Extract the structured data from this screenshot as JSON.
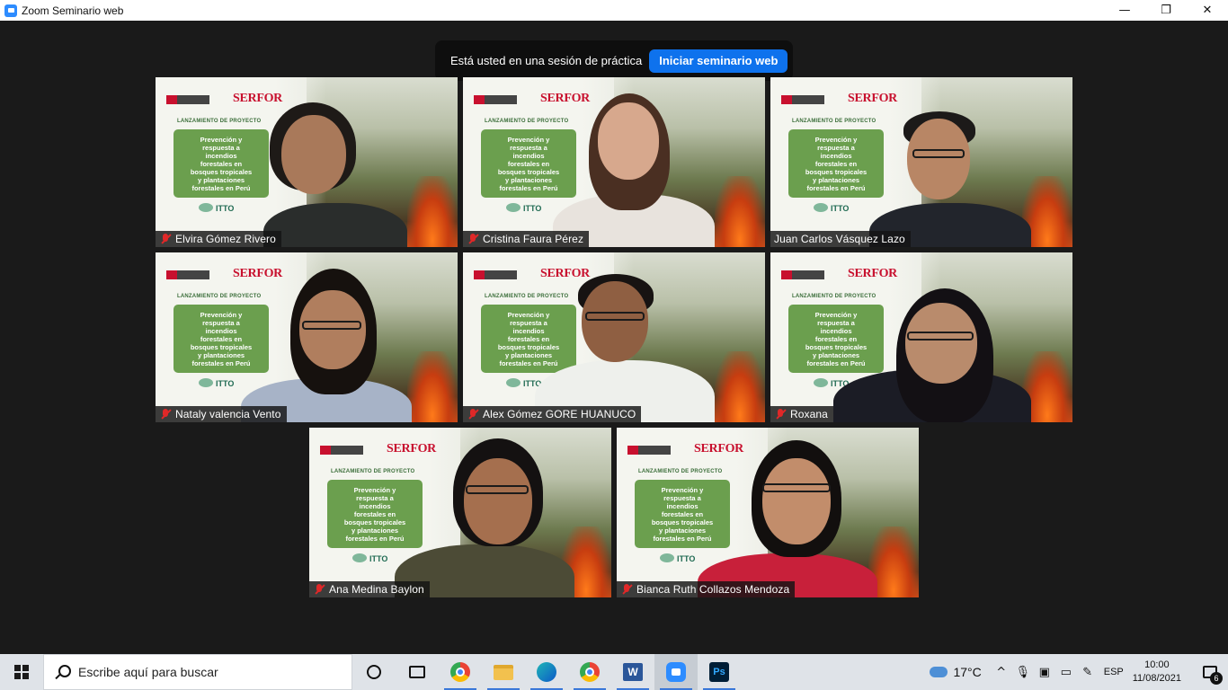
{
  "window": {
    "title": "Zoom Seminario web",
    "minimize": "—",
    "maximize": "❐",
    "close": "✕"
  },
  "banner": {
    "text": "Está usted en una sesión de práctica",
    "button": "Iniciar seminario web"
  },
  "slide": {
    "brand": "SERFOR",
    "label": "LANZAMIENTO DE PROYECTO",
    "card": "Prevención y\nrespuesta a\nincendios\nforestales en\nbosques tropicales\ny plantaciones\nforestales en Perú",
    "partner": "ITTO"
  },
  "participants": [
    {
      "name": "Elvira Gómez Rivero",
      "muted": true
    },
    {
      "name": "Cristina Faura Pérez",
      "muted": true
    },
    {
      "name": "Juan Carlos Vásquez Lazo",
      "muted": false
    },
    {
      "name": "Nataly valencia Vento",
      "muted": true
    },
    {
      "name": "Alex Gómez GORE HUANUCO",
      "muted": true
    },
    {
      "name": "Roxana",
      "muted": true
    },
    {
      "name": "Ana Medina Baylon",
      "muted": true
    },
    {
      "name": "Bianca Ruth Collazos Mendoza",
      "muted": true
    }
  ],
  "taskbar": {
    "search_placeholder": "Escribe aquí para buscar",
    "apps": [
      "cortana-icon",
      "task-view-icon",
      "chrome-icon",
      "file-explorer-icon",
      "edge-icon",
      "chrome-profile-icon",
      "word-icon",
      "zoom-icon",
      "photoshop-icon"
    ],
    "word_label": "W",
    "ps_label": "Ps",
    "temperature": "17°C",
    "language": "ESP",
    "time": "10:00",
    "date": "11/08/2021",
    "notification_count": "6"
  }
}
